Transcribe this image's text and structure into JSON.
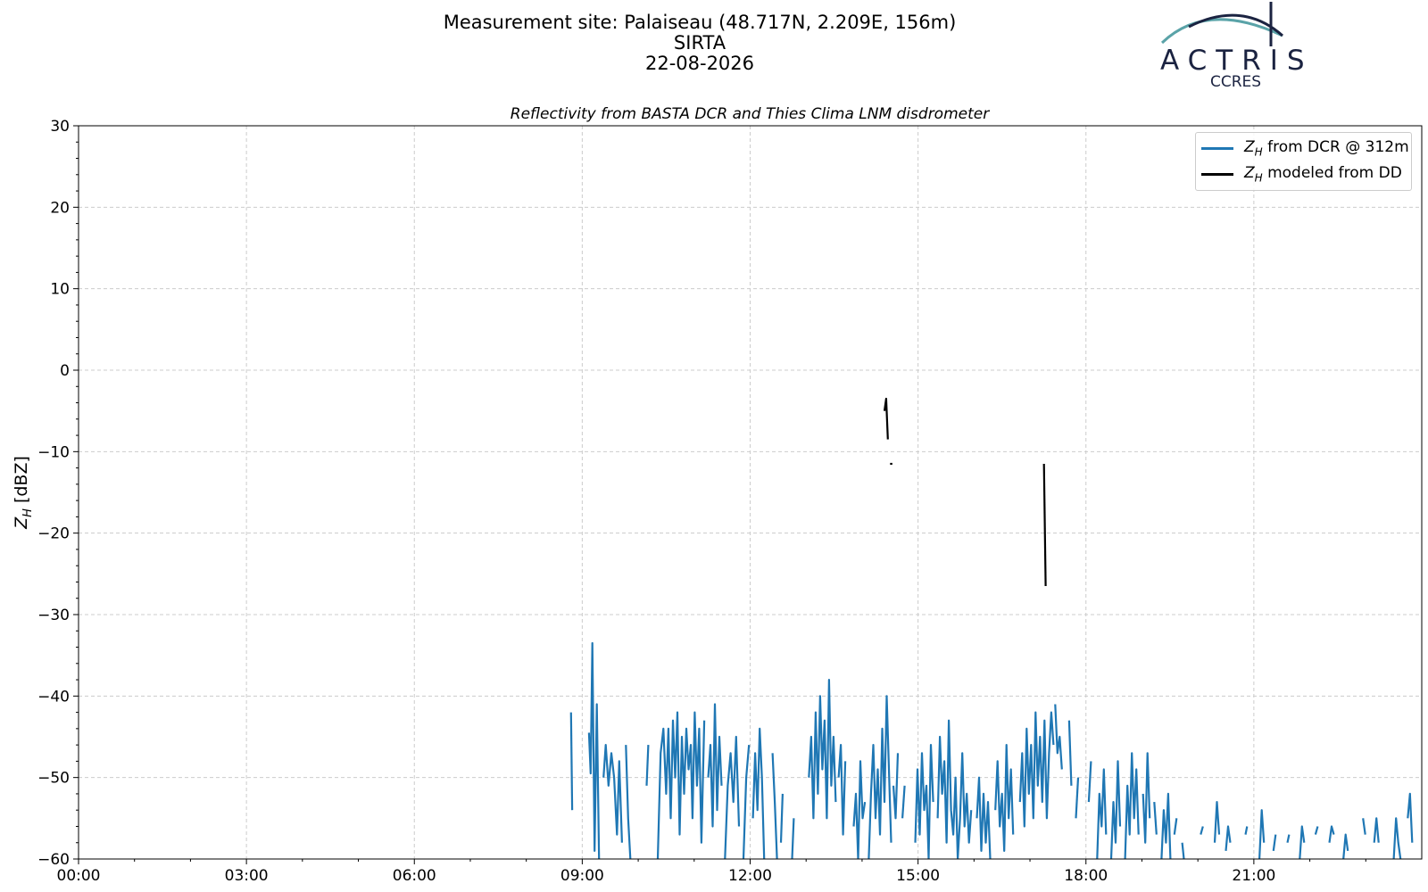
{
  "header": {
    "site": "Measurement site: Palaiseau (48.717N, 2.209E, 156m)",
    "station": "SIRTA",
    "date": "22-08-2026"
  },
  "logo": {
    "name": "ACTRIS",
    "sub": "CCRES"
  },
  "chart_data": {
    "type": "line",
    "title": "Reflectivity from BASTA DCR and Thies Clima LNM disdrometer",
    "xlabel": "",
    "ylabel": "Z_H [dBZ]",
    "xlim": [
      0,
      24
    ],
    "ylim": [
      -60,
      30
    ],
    "x_ticks": [
      "00:00",
      "03:00",
      "06:00",
      "09:00",
      "12:00",
      "15:00",
      "18:00",
      "21:00"
    ],
    "y_ticks": [
      "30",
      "20",
      "10",
      "0",
      "−10",
      "−20",
      "−30",
      "−40",
      "−50",
      "−60"
    ],
    "grid": true,
    "legend_position": "top-right",
    "series": [
      {
        "name": "Z_H from DCR @ 312m",
        "color": "#1f77b4",
        "segments": [
          [
            [
              8.8,
              -42
            ],
            [
              8.82,
              -54
            ]
          ],
          [
            [
              9.12,
              -44.5
            ],
            [
              9.15,
              -49.5
            ],
            [
              9.18,
              -33.5
            ],
            [
              9.22,
              -59
            ],
            [
              9.26,
              -41
            ],
            [
              9.3,
              -60
            ]
          ],
          [
            [
              9.38,
              -50
            ],
            [
              9.42,
              -46
            ],
            [
              9.47,
              -51
            ],
            [
              9.52,
              -47
            ],
            [
              9.57,
              -50
            ],
            [
              9.62,
              -57
            ],
            [
              9.66,
              -48
            ],
            [
              9.71,
              -58
            ]
          ],
          [
            [
              9.78,
              -46
            ],
            [
              9.82,
              -55
            ],
            [
              9.86,
              -60
            ]
          ],
          [
            [
              10.15,
              -51
            ],
            [
              10.18,
              -46
            ]
          ],
          [
            [
              10.35,
              -60
            ],
            [
              10.4,
              -47
            ],
            [
              10.45,
              -44
            ],
            [
              10.5,
              -52
            ],
            [
              10.54,
              -44
            ],
            [
              10.58,
              -55
            ],
            [
              10.62,
              -43
            ],
            [
              10.66,
              -50
            ],
            [
              10.7,
              -42
            ],
            [
              10.74,
              -57
            ],
            [
              10.78,
              -45
            ],
            [
              10.82,
              -52
            ],
            [
              10.86,
              -44
            ],
            [
              10.9,
              -49
            ],
            [
              10.94,
              -46
            ],
            [
              10.97,
              -55
            ],
            [
              11.01,
              -42
            ],
            [
              11.05,
              -51
            ],
            [
              11.09,
              -44
            ],
            [
              11.13,
              -58
            ],
            [
              11.18,
              -43
            ]
          ],
          [
            [
              11.25,
              -50
            ],
            [
              11.29,
              -46
            ],
            [
              11.33,
              -56
            ],
            [
              11.37,
              -41
            ],
            [
              11.41,
              -54
            ],
            [
              11.45,
              -45
            ],
            [
              11.49,
              -51
            ]
          ],
          [
            [
              11.55,
              -60
            ],
            [
              11.6,
              -51
            ],
            [
              11.65,
              -47
            ],
            [
              11.7,
              -53
            ],
            [
              11.75,
              -45
            ],
            [
              11.8,
              -56
            ]
          ],
          [
            [
              11.88,
              -60
            ],
            [
              11.93,
              -50
            ],
            [
              11.98,
              -46
            ]
          ],
          [
            [
              12.05,
              -55
            ],
            [
              12.09,
              -47
            ],
            [
              12.13,
              -54
            ],
            [
              12.17,
              -44
            ],
            [
              12.21,
              -50
            ],
            [
              12.25,
              -60
            ]
          ],
          [
            [
              12.4,
              -47
            ],
            [
              12.44,
              -53
            ],
            [
              12.48,
              -60
            ]
          ],
          [
            [
              12.55,
              -58
            ],
            [
              12.58,
              -52
            ]
          ],
          [
            [
              12.75,
              -60
            ],
            [
              12.78,
              -55
            ]
          ],
          [
            [
              13.05,
              -50
            ],
            [
              13.09,
              -45
            ],
            [
              13.13,
              -55
            ],
            [
              13.17,
              -42
            ],
            [
              13.21,
              -52
            ],
            [
              13.25,
              -40
            ],
            [
              13.29,
              -49
            ],
            [
              13.33,
              -43
            ],
            [
              13.37,
              -55
            ],
            [
              13.41,
              -38
            ],
            [
              13.45,
              -51
            ],
            [
              13.49,
              -45
            ],
            [
              13.53,
              -53
            ]
          ],
          [
            [
              13.58,
              -50
            ],
            [
              13.62,
              -46
            ],
            [
              13.66,
              -57
            ],
            [
              13.7,
              -48
            ]
          ],
          [
            [
              13.85,
              -56
            ],
            [
              13.89,
              -52
            ],
            [
              13.93,
              -60
            ],
            [
              13.97,
              -48
            ],
            [
              14.01,
              -55
            ],
            [
              14.05,
              -53
            ]
          ],
          [
            [
              14.12,
              -60
            ],
            [
              14.16,
              -52
            ],
            [
              14.2,
              -46
            ],
            [
              14.24,
              -55
            ],
            [
              14.28,
              -49
            ],
            [
              14.32,
              -57
            ],
            [
              14.36,
              -44
            ],
            [
              14.4,
              -53
            ],
            [
              14.44,
              -40
            ],
            [
              14.48,
              -49
            ],
            [
              14.52,
              -58
            ]
          ],
          [
            [
              14.56,
              -51
            ],
            [
              14.6,
              -55
            ],
            [
              14.64,
              -47
            ]
          ],
          [
            [
              14.72,
              -55
            ],
            [
              14.76,
              -51
            ]
          ],
          [
            [
              14.95,
              -58
            ],
            [
              14.99,
              -49
            ],
            [
              15.03,
              -57
            ],
            [
              15.07,
              -47
            ],
            [
              15.11,
              -54
            ],
            [
              15.15,
              -51
            ],
            [
              15.19,
              -60
            ],
            [
              15.23,
              -46
            ],
            [
              15.27,
              -53
            ]
          ],
          [
            [
              15.35,
              -55
            ],
            [
              15.39,
              -45
            ],
            [
              15.43,
              -52
            ],
            [
              15.47,
              -48
            ],
            [
              15.51,
              -58
            ],
            [
              15.55,
              -43
            ],
            [
              15.59,
              -54
            ],
            [
              15.63,
              -57
            ],
            [
              15.67,
              -50
            ],
            [
              15.71,
              -60
            ],
            [
              15.75,
              -55
            ],
            [
              15.79,
              -47
            ],
            [
              15.83,
              -56
            ],
            [
              15.87,
              -52
            ],
            [
              15.91,
              -58
            ],
            [
              15.95,
              -54
            ]
          ],
          [
            [
              16.05,
              -55
            ],
            [
              16.09,
              -50
            ],
            [
              16.13,
              -59
            ],
            [
              16.17,
              -52
            ],
            [
              16.21,
              -58
            ],
            [
              16.25,
              -53
            ],
            [
              16.29,
              -60
            ]
          ],
          [
            [
              16.38,
              -54
            ],
            [
              16.42,
              -48
            ],
            [
              16.46,
              -56
            ],
            [
              16.5,
              -52
            ],
            [
              16.54,
              -59
            ],
            [
              16.58,
              -46
            ],
            [
              16.62,
              -55
            ],
            [
              16.66,
              -49
            ],
            [
              16.7,
              -57
            ]
          ],
          [
            [
              16.82,
              -53
            ],
            [
              16.86,
              -47
            ],
            [
              16.9,
              -56
            ],
            [
              16.94,
              -44
            ],
            [
              16.98,
              -52
            ],
            [
              17.02,
              -46
            ],
            [
              17.06,
              -55
            ],
            [
              17.1,
              -42
            ],
            [
              17.14,
              -51
            ],
            [
              17.18,
              -45
            ],
            [
              17.22,
              -53
            ],
            [
              17.26,
              -43
            ],
            [
              17.3,
              -55
            ],
            [
              17.34,
              -47
            ],
            [
              17.38,
              -42
            ],
            [
              17.42,
              -46
            ]
          ],
          [
            [
              17.45,
              -41
            ],
            [
              17.49,
              -47
            ],
            [
              17.53,
              -45
            ],
            [
              17.57,
              -49
            ]
          ],
          [
            [
              17.7,
              -43
            ],
            [
              17.74,
              -51
            ]
          ],
          [
            [
              17.82,
              -55
            ],
            [
              17.86,
              -50
            ]
          ],
          [
            [
              18.05,
              -53
            ],
            [
              18.09,
              -48
            ]
          ],
          [
            [
              18.2,
              -60
            ],
            [
              18.24,
              -52
            ],
            [
              18.28,
              -56
            ],
            [
              18.32,
              -49
            ],
            [
              18.36,
              -57
            ]
          ],
          [
            [
              18.45,
              -60
            ],
            [
              18.49,
              -53
            ],
            [
              18.53,
              -58
            ],
            [
              18.57,
              -48
            ],
            [
              18.61,
              -56
            ]
          ],
          [
            [
              18.7,
              -60
            ],
            [
              18.74,
              -51
            ],
            [
              18.78,
              -57
            ],
            [
              18.82,
              -47
            ],
            [
              18.86,
              -55
            ],
            [
              18.9,
              -49
            ],
            [
              18.94,
              -57
            ]
          ],
          [
            [
              19.02,
              -52
            ],
            [
              19.06,
              -58
            ],
            [
              19.1,
              -47
            ],
            [
              19.14,
              -55
            ]
          ],
          [
            [
              19.22,
              -53
            ],
            [
              19.26,
              -57
            ]
          ],
          [
            [
              19.35,
              -60
            ],
            [
              19.39,
              -54
            ],
            [
              19.43,
              -58
            ],
            [
              19.47,
              -52
            ],
            [
              19.51,
              -60
            ]
          ],
          [
            [
              19.58,
              -57
            ],
            [
              19.62,
              -55
            ]
          ],
          [
            [
              19.72,
              -58
            ],
            [
              19.75,
              -60
            ]
          ],
          [
            [
              20.05,
              -57
            ],
            [
              20.09,
              -56
            ]
          ],
          [
            [
              20.3,
              -58
            ],
            [
              20.34,
              -53
            ],
            [
              20.38,
              -57
            ]
          ],
          [
            [
              20.5,
              -59
            ],
            [
              20.54,
              -56
            ],
            [
              20.58,
              -58
            ]
          ],
          [
            [
              20.85,
              -57
            ],
            [
              20.88,
              -56
            ]
          ],
          [
            [
              21.1,
              -60
            ],
            [
              21.14,
              -54
            ],
            [
              21.18,
              -58
            ]
          ],
          [
            [
              21.35,
              -59
            ],
            [
              21.39,
              -57
            ]
          ],
          [
            [
              21.6,
              -58
            ],
            [
              21.63,
              -57
            ]
          ],
          [
            [
              21.82,
              -60
            ],
            [
              21.86,
              -56
            ],
            [
              21.9,
              -58
            ]
          ],
          [
            [
              22.1,
              -57
            ],
            [
              22.14,
              -56
            ]
          ],
          [
            [
              22.35,
              -58
            ],
            [
              22.39,
              -56
            ],
            [
              22.43,
              -57
            ]
          ],
          [
            [
              22.6,
              -60
            ],
            [
              22.64,
              -57
            ],
            [
              22.68,
              -59
            ]
          ],
          [
            [
              22.95,
              -55
            ],
            [
              22.99,
              -57
            ]
          ],
          [
            [
              23.15,
              -58
            ],
            [
              23.19,
              -55
            ],
            [
              23.23,
              -58
            ]
          ],
          [
            [
              23.5,
              -60
            ],
            [
              23.54,
              -55
            ],
            [
              23.58,
              -58
            ],
            [
              23.62,
              -60
            ]
          ],
          [
            [
              23.75,
              -55
            ],
            [
              23.79,
              -52
            ],
            [
              23.83,
              -58
            ]
          ]
        ]
      },
      {
        "name": "Z_H modeled from DD",
        "color": "#000000",
        "segments": [
          [
            [
              14.4,
              -5
            ],
            [
              14.43,
              -3.5
            ],
            [
              14.46,
              -8.5
            ]
          ],
          [
            [
              14.5,
              -11.5
            ],
            [
              14.54,
              -11.5
            ]
          ],
          [
            [
              17.25,
              -11.5
            ],
            [
              17.28,
              -26.5
            ]
          ]
        ]
      }
    ]
  }
}
